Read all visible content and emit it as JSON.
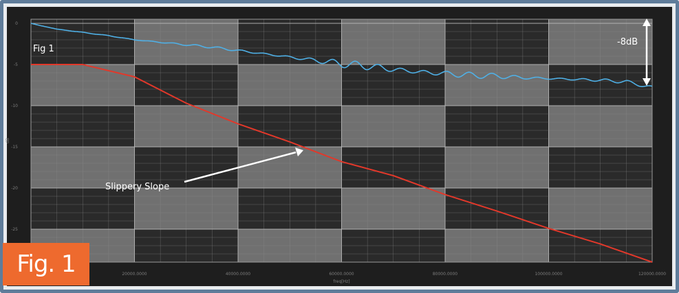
{
  "chart_data": {
    "type": "line",
    "xlabel": "freq[Hz]",
    "ylabel": "dB",
    "x_tick_labels": [
      "20000.0000",
      "40000.0000",
      "60000.0000",
      "80000.0000",
      "100000.0000",
      "120000.0000"
    ],
    "y_tick_labels": [
      "0",
      "-5",
      "-10",
      "-15",
      "-20",
      "-25"
    ],
    "xlim": [
      0,
      120000
    ],
    "ylim": [
      -29,
      0.5
    ],
    "grid": true,
    "series": [
      {
        "color": "#4fb0e6",
        "x": [
          0,
          2000,
          5000,
          10000,
          15000,
          20000,
          25000,
          30000,
          35000,
          40000,
          45000,
          50000,
          55000,
          60000,
          65000,
          70000,
          75000,
          80000,
          85000,
          90000,
          95000,
          100000,
          105000,
          110000,
          115000,
          120000
        ],
        "y": [
          0.0,
          -0.3,
          -0.7,
          -1.1,
          -1.5,
          -2.0,
          -2.3,
          -2.6,
          -2.9,
          -3.3,
          -3.7,
          -4.1,
          -4.5,
          -4.9,
          -5.2,
          -5.6,
          -5.9,
          -6.1,
          -6.3,
          -6.4,
          -6.6,
          -6.7,
          -6.8,
          -6.9,
          -7.1,
          -7.8
        ],
        "ripple_amplitude": [
          0.0,
          0.0,
          0.0,
          0.03,
          0.05,
          0.07,
          0.09,
          0.11,
          0.13,
          0.15,
          0.18,
          0.24,
          0.3,
          0.45,
          0.5,
          0.5,
          0.5,
          0.45,
          0.38,
          0.3,
          0.25,
          0.22,
          0.2,
          0.2,
          0.2,
          0.2
        ]
      },
      {
        "color": "#e2382a",
        "x": [
          0,
          10000,
          20000,
          30000,
          40000,
          50000,
          60000,
          70000,
          80000,
          90000,
          100000,
          110000,
          120000
        ],
        "y": [
          -5.0,
          -5.0,
          -6.5,
          -9.7,
          -12.2,
          -14.4,
          -16.8,
          -18.5,
          -20.8,
          -22.8,
          -24.9,
          -26.8,
          -29.0
        ]
      }
    ]
  },
  "annotations": {
    "fig_label_small": "Fig 1",
    "arrow_label": "-8dB",
    "slope_label": "Slippery Slope",
    "badge_text": "Fig. 1"
  },
  "colors": {
    "plot_dark": "#2a2a2a",
    "plot_light": "#707070",
    "badge": "#ee6a2e",
    "frame": "#5f7c9a"
  }
}
